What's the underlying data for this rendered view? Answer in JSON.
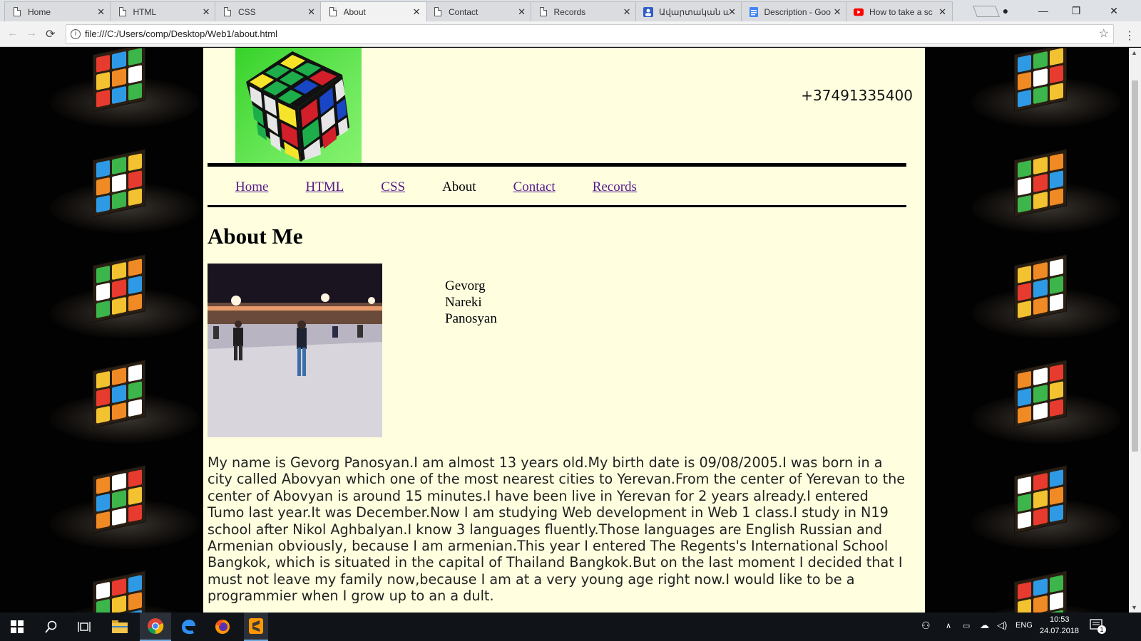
{
  "browser": {
    "tabs": [
      {
        "label": "Home",
        "icon": "document-icon",
        "active": false
      },
      {
        "label": "HTML",
        "icon": "document-icon",
        "active": false
      },
      {
        "label": "CSS",
        "icon": "document-icon",
        "active": false
      },
      {
        "label": "About",
        "icon": "document-icon",
        "active": true
      },
      {
        "label": "Contact",
        "icon": "document-icon",
        "active": false
      },
      {
        "label": "Records",
        "icon": "document-icon",
        "active": false
      },
      {
        "label": "Ավարտական ա",
        "icon": "contacts-icon",
        "active": false
      },
      {
        "label": "Description - Goo",
        "icon": "docs-icon",
        "active": false
      },
      {
        "label": "How to take a sc",
        "icon": "youtube-icon",
        "active": false
      }
    ],
    "close_glyph": "✕",
    "url": "file:///C:/Users/comp/Desktop/Web1/about.html",
    "info_glyph": "i",
    "star_glyph": "☆",
    "back_glyph": "←",
    "forward_glyph": "→",
    "reload_glyph": "⟳",
    "menu_glyph": "⋮",
    "minimize_glyph": "—",
    "maximize_glyph": "❐",
    "window_close_glyph": "✕",
    "profile_glyph": "●"
  },
  "page": {
    "phone": "+37491335400",
    "nav": [
      {
        "label": "Home",
        "link": true
      },
      {
        "label": "HTML",
        "link": true
      },
      {
        "label": "CSS",
        "link": true
      },
      {
        "label": "About",
        "link": false
      },
      {
        "label": "Contact",
        "link": true
      },
      {
        "label": "Records",
        "link": true
      }
    ],
    "heading": "About Me",
    "name_lines": [
      "Gevorg",
      "Nareki",
      "Panosyan"
    ],
    "bio": "My name is Gevorg Panosyan.I am almost 13 years old.My birth date is 09/08/2005.I was born in a city called Abovyan which one of the most nearest cities to Yerevan.From the center of Yerevan to the center of Abovyan is around 15 minutes.I have been live in Yerevan for 2 years already.I entered Tumo last year.It was December.Now I am studying Web development in Web 1 class.I study in N19 school after Nikol Aghbalyan.I know 3 languages fluently.Those languages are English Russian and Armenian obviously, because I am armenian.This year I entered The Regents's International School Bangkok, which is situated in the capital of Thailand Bangkok.But on the last moment I decided that I must not leave my family now,because I am at a very young age right now.I would like to be a programmier when I grow up to an a dult."
  },
  "taskbar": {
    "language": "ENG",
    "time": "10:53",
    "date": "24.07.2018",
    "notification_count": "1"
  },
  "colors": {
    "page_bg": "#ffffe0",
    "visited_link": "#551a8b",
    "logo_green": "#4ee03c"
  }
}
